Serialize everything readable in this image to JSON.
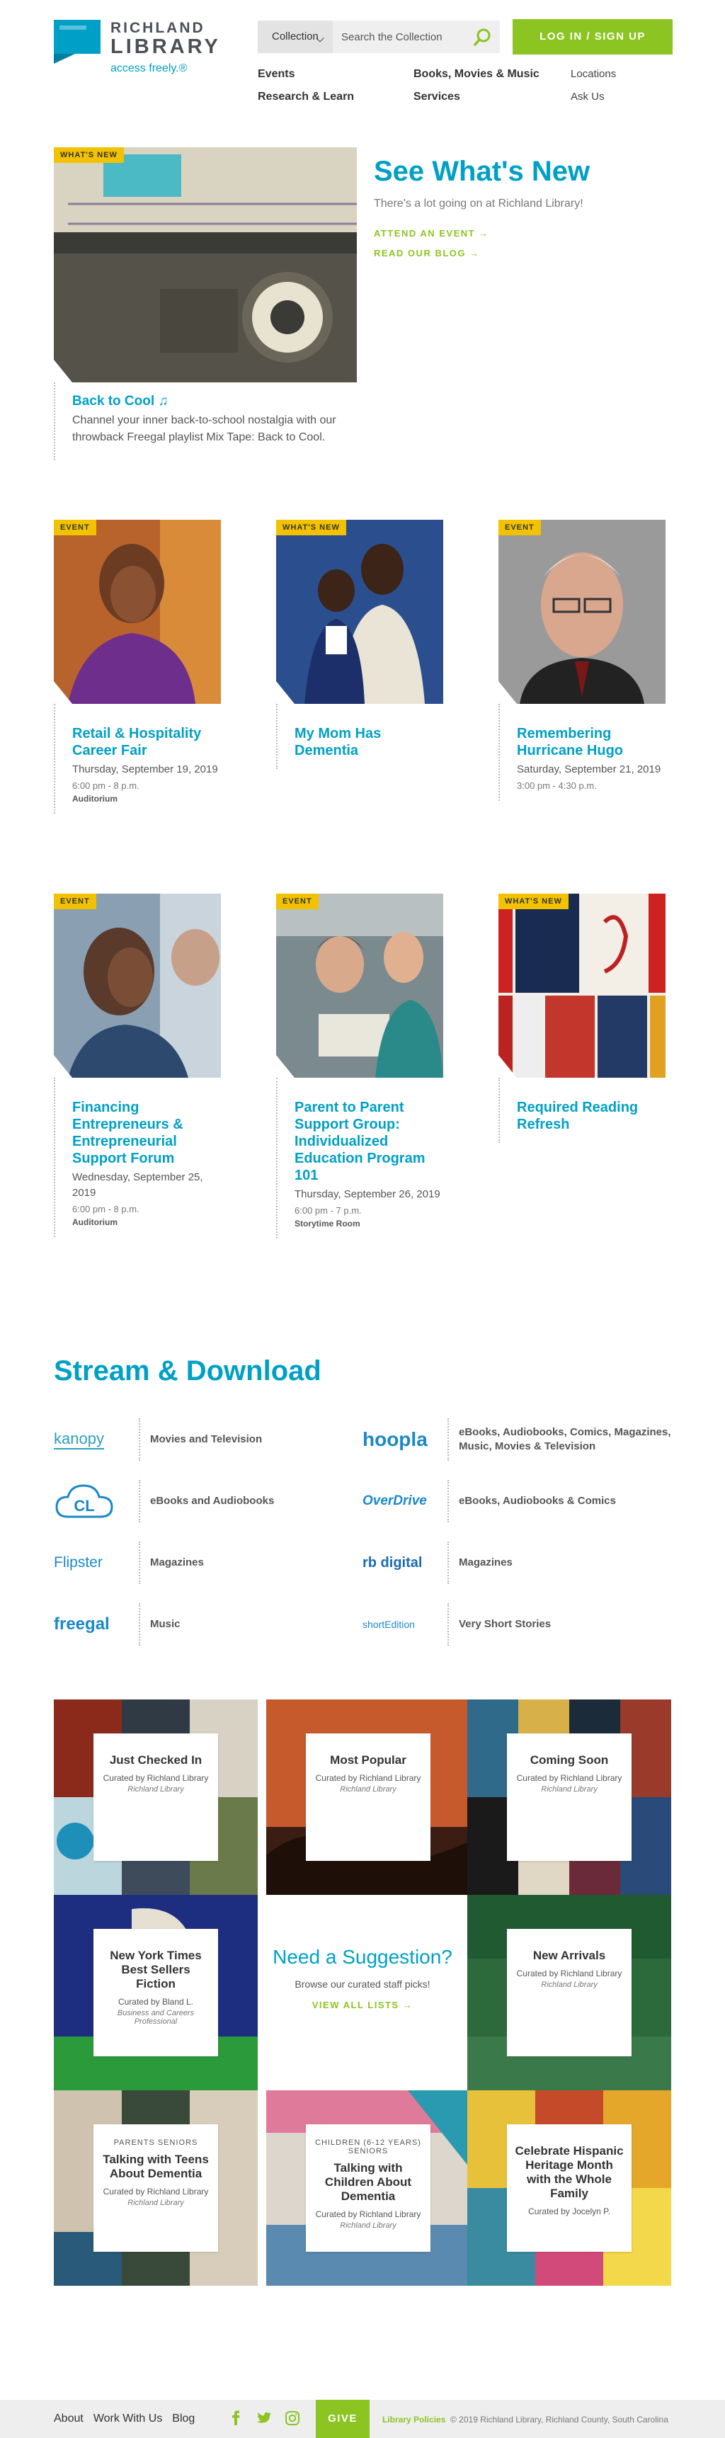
{
  "header": {
    "logo": {
      "line1": "RICHLAND",
      "line2": "LIBRARY",
      "tagline": "access freely.®"
    },
    "search": {
      "collection_label": "Collection",
      "placeholder": "Search the Collection"
    },
    "login_label": "LOG IN / SIGN UP",
    "nav_primary": [
      "Events",
      "Research & Learn",
      "Books, Movies & Music",
      "Services"
    ],
    "nav_secondary": [
      "Locations",
      "Ask Us"
    ]
  },
  "hero": {
    "tag": "WHAT'S NEW",
    "caption_title": "Back to Cool",
    "caption_desc": "Channel your inner back-to-school nostalgia with our throwback Freegal playlist Mix Tape: Back to Cool.",
    "heading": "See What's New",
    "subheading": "There's a lot going on at Richland Library!",
    "link_events": "ATTEND AN EVENT →",
    "link_blog": "READ OUR BLOG →"
  },
  "cards": [
    {
      "tag": "EVENT",
      "title": "Retail & Hospitality Career Fair",
      "date": "Thursday, September 19, 2019",
      "time": "6:00 pm - 8 p.m.",
      "location": "Auditorium"
    },
    {
      "tag": "WHAT'S NEW",
      "title": "My Mom Has Dementia",
      "date": "",
      "time": "",
      "location": ""
    },
    {
      "tag": "EVENT",
      "title": "Remembering Hurricane Hugo",
      "date": "Saturday, September 21, 2019",
      "time": "3:00 pm - 4:30 p.m.",
      "location": ""
    },
    {
      "tag": "EVENT",
      "title": "Financing Entrepreneurs & Entrepreneurial Support Forum",
      "date": "Wednesday, September 25, 2019",
      "time": "6:00 pm - 8 p.m.",
      "location": "Auditorium"
    },
    {
      "tag": "EVENT",
      "title": "Parent to Parent Support Group: Individualized Education Program 101",
      "date": "Thursday, September 26, 2019",
      "time": "6:00 pm - 7 p.m.",
      "location": "Storytime Room"
    },
    {
      "tag": "WHAT'S NEW",
      "title": "Required Reading Refresh",
      "date": "",
      "time": "",
      "location": ""
    }
  ],
  "stream": {
    "heading": "Stream & Download",
    "services": [
      {
        "logo": "kanopy",
        "desc": "Movies and Television",
        "color": "#2a9fc1"
      },
      {
        "logo": "hoopla",
        "desc": "eBooks, Audiobooks, Comics, Magazines, Music, Movies & Television",
        "color": "#1a88c9"
      },
      {
        "logo": "CL",
        "desc": "eBooks and Audiobooks",
        "color": "#1a88c9"
      },
      {
        "logo": "OverDrive",
        "desc": "eBooks, Audiobooks & Comics",
        "color": "#1a88c9"
      },
      {
        "logo": "Flipster",
        "desc": "Magazines",
        "color": "#1a88c9"
      },
      {
        "logo": "rb digital",
        "desc": "Magazines",
        "color": "#1a6bb5"
      },
      {
        "logo": "freegal",
        "desc": "Music",
        "color": "#1a88c9"
      },
      {
        "logo": "shortEdition",
        "desc": "Very Short Stories",
        "color": "#1a88c9"
      }
    ]
  },
  "lists": {
    "center": {
      "title": "Need a Suggestion?",
      "sub": "Browse our curated staff picks!",
      "link": "VIEW ALL LISTS →"
    },
    "tiles": [
      {
        "kicker": "",
        "title": "Just Checked In",
        "curated": "Curated by Richland Library",
        "by": "Richland Library"
      },
      {
        "kicker": "",
        "title": "Most Popular",
        "curated": "Curated by Richland Library",
        "by": "Richland Library"
      },
      {
        "kicker": "",
        "title": "Coming Soon",
        "curated": "Curated by Richland Library",
        "by": "Richland Library"
      },
      {
        "kicker": "",
        "title": "New York Times Best Sellers Fiction",
        "curated": "Curated by Bland L.",
        "by": "Business and Careers Professional"
      },
      {
        "kicker": "",
        "title": "New Arrivals",
        "curated": "Curated by Richland Library",
        "by": "Richland Library"
      },
      {
        "kicker": "PARENTS SENIORS",
        "title": "Talking with Teens About Dementia",
        "curated": "Curated by Richland Library",
        "by": "Richland Library"
      },
      {
        "kicker": "CHILDREN (6-12 YEARS) SENIORS",
        "title": "Talking with Children About Dementia",
        "curated": "Curated by Richland Library",
        "by": "Richland Library"
      },
      {
        "kicker": "",
        "title": "Celebrate Hispanic Heritage Month with the Whole Family",
        "curated": "Curated by Jocelyn P.",
        "by": ""
      }
    ]
  },
  "footer": {
    "links": [
      "About",
      "Work With Us",
      "Blog"
    ],
    "give": "GIVE",
    "policy": "Library Policies",
    "copyright": "© 2019 Richland Library, Richland County, South Carolina"
  }
}
